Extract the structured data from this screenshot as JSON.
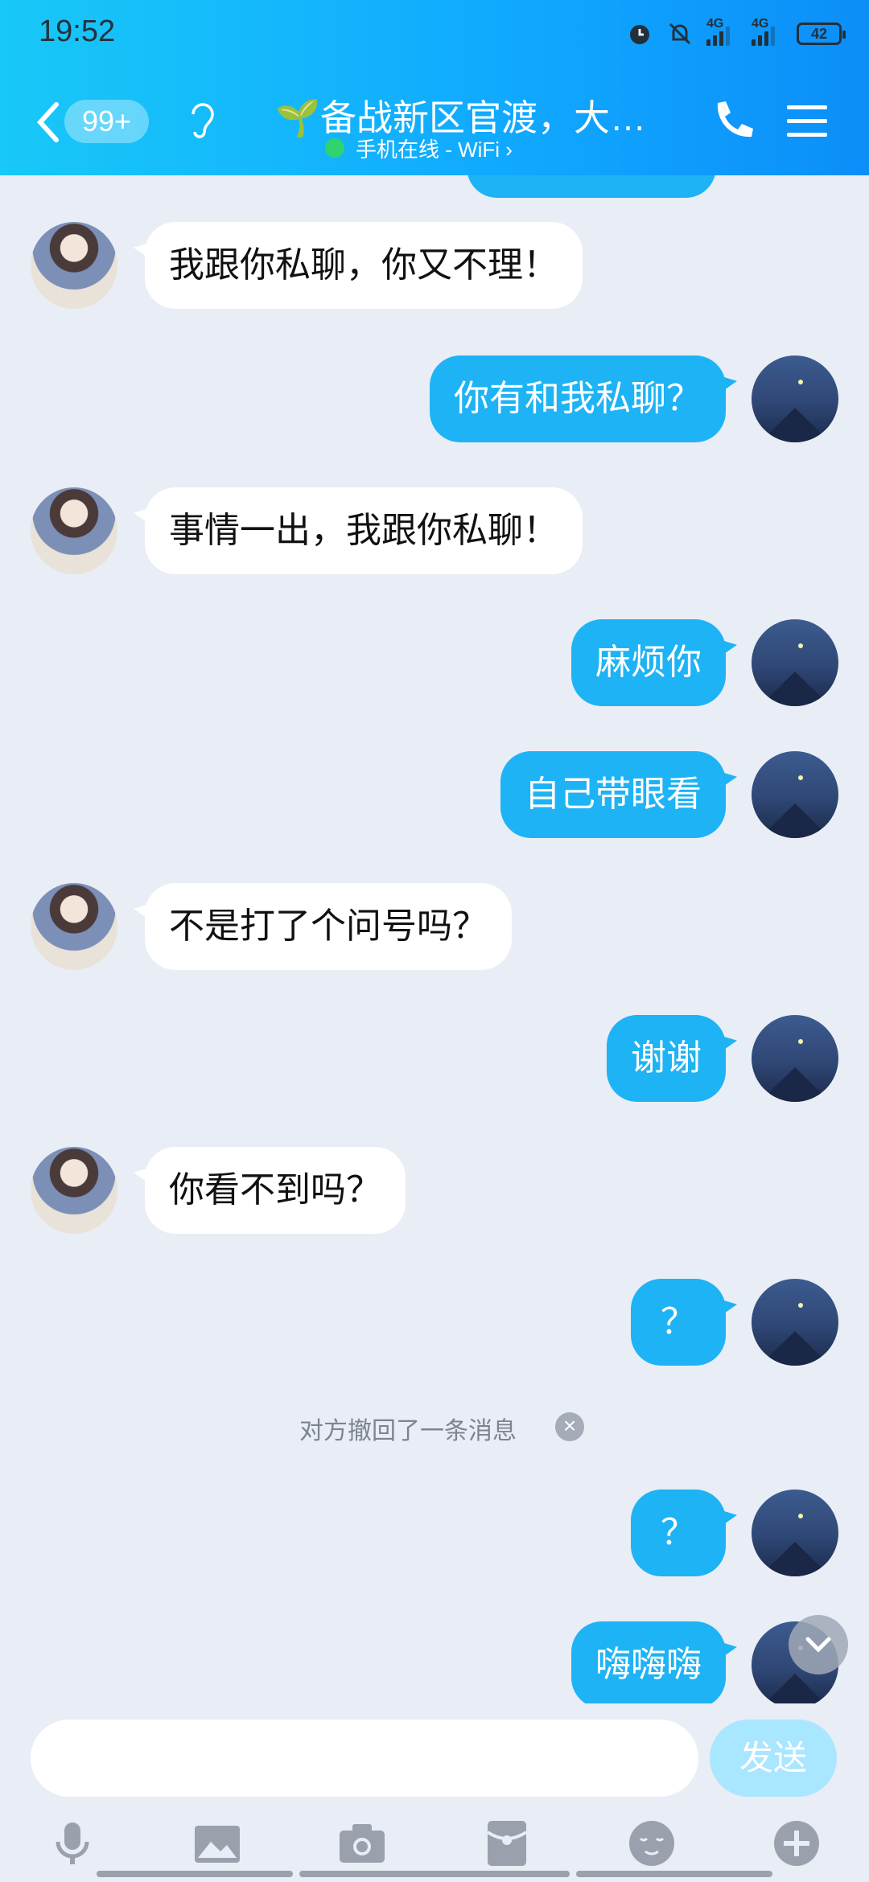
{
  "status_bar": {
    "time": "19:52",
    "network_1": "4G",
    "network_2": "4G",
    "battery": "42"
  },
  "header": {
    "unread_count": "99+",
    "title": "🌱备战新区官渡，大佬带…",
    "subtitle": "手机在线 - WiFi ›"
  },
  "messages": [
    {
      "side": "other",
      "text": "我跟你私聊，你又不理！"
    },
    {
      "side": "self",
      "text": "你有和我私聊？"
    },
    {
      "side": "other",
      "text": "事情一出，我跟你私聊！"
    },
    {
      "side": "self",
      "text": "麻烦你"
    },
    {
      "side": "self",
      "text": "自己带眼看"
    },
    {
      "side": "other",
      "text": "不是打了个问号吗？"
    },
    {
      "side": "self",
      "text": "谢谢"
    },
    {
      "side": "other",
      "text": "你看不到吗？"
    },
    {
      "side": "self",
      "text": "？"
    },
    {
      "side": "self",
      "text": "？"
    },
    {
      "side": "self",
      "text": "嗨嗨嗨"
    }
  ],
  "system_notice": "对方撤回了一条消息",
  "composer": {
    "input_value": "",
    "send_label": "发送"
  },
  "toolbar": {
    "icons": [
      "microphone-icon",
      "image-icon",
      "camera-icon",
      "red-packet-icon",
      "emoji-icon",
      "plus-icon"
    ]
  },
  "colors": {
    "header_gradient_start": "#18c8f7",
    "header_gradient_end": "#0c8ef8",
    "self_bubble": "#1eb3f5",
    "other_bubble": "#ffffff",
    "background": "#e9edf5"
  }
}
